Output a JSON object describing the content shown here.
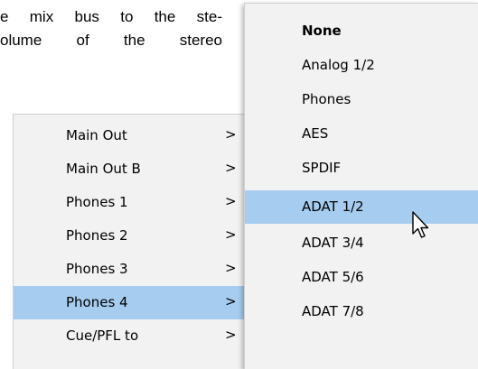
{
  "document": {
    "lines": [
      "e mix bus to the ste-",
      "olume of the stereo"
    ]
  },
  "left_menu": {
    "items": [
      {
        "label": "Main Out",
        "chevron": ">"
      },
      {
        "label": "Main Out B",
        "chevron": ">"
      },
      {
        "label": "Phones 1",
        "chevron": ">"
      },
      {
        "label": "Phones 2",
        "chevron": ">"
      },
      {
        "label": "Phones 3",
        "chevron": ">"
      },
      {
        "label": "Phones 4",
        "chevron": ">"
      },
      {
        "label": "Cue/PFL to",
        "chevron": ">"
      }
    ],
    "selected": "Phones 4"
  },
  "right_menu": {
    "items": [
      {
        "label": "None"
      },
      {
        "label": "Analog 1/2"
      },
      {
        "label": "Phones"
      },
      {
        "label": "AES"
      },
      {
        "label": "SPDIF"
      },
      {
        "label": "ADAT 1/2"
      },
      {
        "label": "ADAT 3/4"
      },
      {
        "label": "ADAT 5/6"
      },
      {
        "label": "ADAT 7/8"
      }
    ],
    "selected": "ADAT 1/2",
    "bold_item": "None"
  },
  "colors": {
    "highlight": "#a6cdf0",
    "menu_bg": "#f2f2f2"
  },
  "cursor_icon": "arrow-pointer-icon"
}
